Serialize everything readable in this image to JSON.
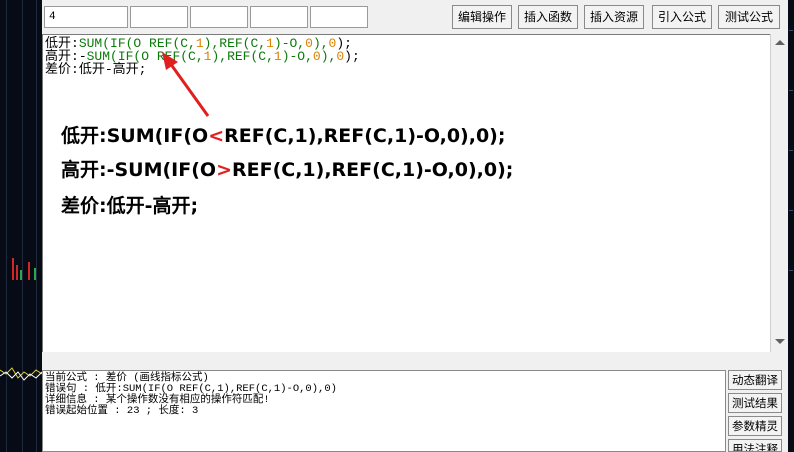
{
  "toolbar": {
    "field_value": "4",
    "buttons": [
      "编辑操作",
      "插入函数",
      "插入资源",
      "引入公式",
      "测试公式"
    ]
  },
  "editor": {
    "code_lines": [
      {
        "label": "低开",
        "sep": ":",
        "parts": [
          [
            "kw",
            "SUM(IF(O REF(C,"
          ],
          [
            "num",
            "1"
          ],
          [
            "kw",
            "),REF(C,"
          ],
          [
            "num",
            "1"
          ],
          [
            "kw",
            ")-O,"
          ],
          [
            "num",
            "0"
          ],
          [
            "kw",
            "),"
          ],
          [
            "num",
            "0"
          ],
          [
            "plain",
            ");"
          ]
        ]
      },
      {
        "label": "高开",
        "sep": ":-",
        "parts": [
          [
            "kw",
            "SUM(IF(O REF(C,"
          ],
          [
            "num",
            "1"
          ],
          [
            "kw",
            "),REF(C,"
          ],
          [
            "num",
            "1"
          ],
          [
            "kw",
            ")-O,"
          ],
          [
            "num",
            "0"
          ],
          [
            "kw",
            "),"
          ],
          [
            "num",
            "0"
          ],
          [
            "plain",
            ");"
          ]
        ]
      },
      {
        "label": "差价",
        "sep": ":",
        "parts": [
          [
            "plain",
            "低开-高开;"
          ]
        ]
      }
    ],
    "annotation_lines": [
      {
        "before": "低开:SUM(IF(O",
        "op": "<",
        "after": "REF(C,1),REF(C,1)-O,0),0);"
      },
      {
        "before": "高开:-SUM(IF(O",
        "op": ">",
        "after": "REF(C,1),REF(C,1)-O,0),0);"
      },
      {
        "before": "差价:低开-高开;",
        "op": "",
        "after": ""
      }
    ]
  },
  "errors": {
    "lines": [
      "当前公式 : 差价 (画线指标公式)",
      "错误句 : 低开:SUM(IF(O REF(C,1),REF(C,1)-O,0),0)",
      "详细信息 : 某个操作数没有相应的操作符匹配!",
      "错误起始位置 : 23 ; 长度: 3"
    ]
  },
  "side_buttons": [
    "动态翻译",
    "测试结果",
    "参数精灵",
    "用法注释"
  ],
  "colors": {
    "keyword": "#0a7a0a",
    "number": "#d98300",
    "arrow": "#e02020"
  }
}
